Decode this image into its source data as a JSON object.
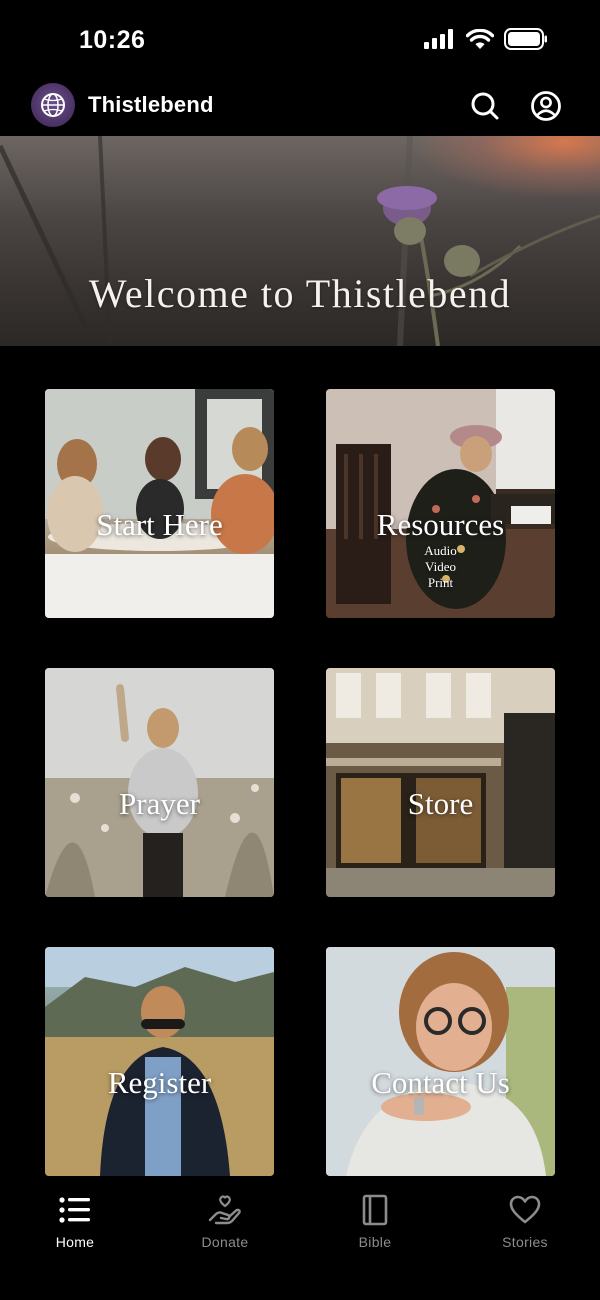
{
  "status_bar": {
    "time": "10:26"
  },
  "header": {
    "title": "Thistlebend"
  },
  "hero": {
    "title": "Welcome to Thistlebend"
  },
  "tiles": [
    {
      "label": "Start Here"
    },
    {
      "label": "Resources",
      "sub": [
        "Audio",
        "Video",
        "Print"
      ]
    },
    {
      "label": "Prayer"
    },
    {
      "label": "Store"
    },
    {
      "label": "Register"
    },
    {
      "label": "Contact Us"
    }
  ],
  "tab_bar": {
    "items": [
      {
        "label": "Home",
        "icon": "list-icon",
        "active": true
      },
      {
        "label": "Donate",
        "icon": "donate-hand-heart-icon",
        "active": false
      },
      {
        "label": "Bible",
        "icon": "book-icon",
        "active": false
      },
      {
        "label": "Stories",
        "icon": "heart-icon",
        "active": false
      }
    ]
  },
  "colors": {
    "background": "#000000",
    "logo": "#4a3163",
    "inactive_tab": "#8c8c8c",
    "active_tab": "#ffffff"
  }
}
